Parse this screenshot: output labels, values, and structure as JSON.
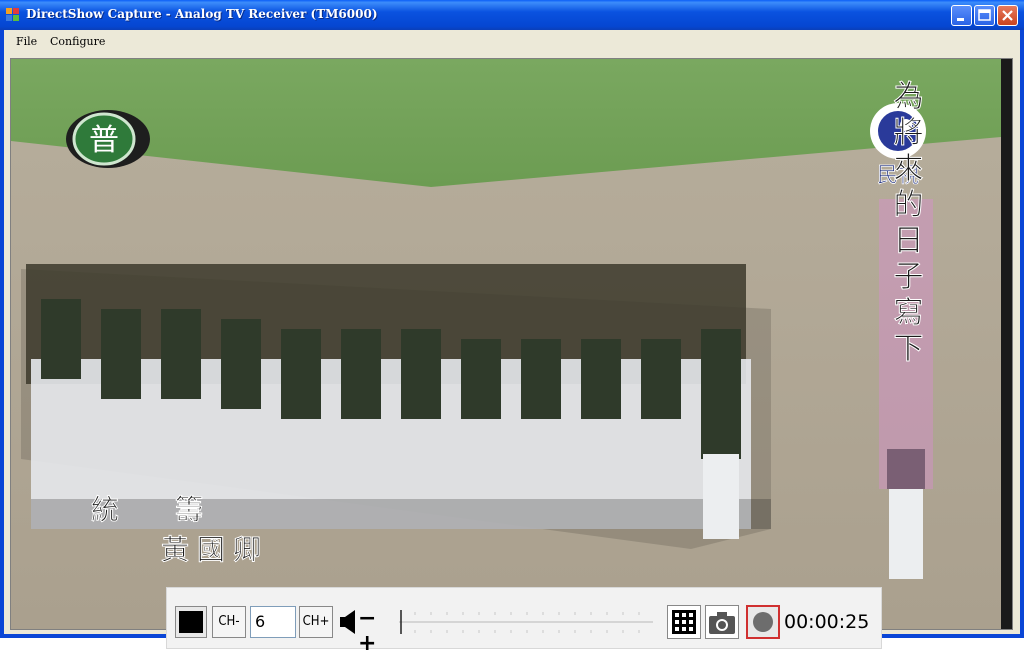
{
  "window": {
    "title": "DirectShow Capture - Analog TV Receiver (TM6000)"
  },
  "menu": {
    "items": [
      "File",
      "Configure"
    ]
  },
  "video": {
    "station_badge": "普",
    "channel_logo_text": "民視",
    "caption_vertical": "為將來的日子寫下",
    "caption_bottom_line1": "統　　籌",
    "caption_bottom_line2": "黃國卿"
  },
  "controls": {
    "stop_icon": "stop-icon",
    "channel_down_label": "CH-",
    "channel_value": "6",
    "channel_up_label": "CH+",
    "volume_icon": "speaker-icon",
    "volume_label": "−+",
    "grid_icon": "grid-icon",
    "snapshot_icon": "camera-icon",
    "record_icon": "record-icon",
    "elapsed_time": "00:00:25"
  }
}
